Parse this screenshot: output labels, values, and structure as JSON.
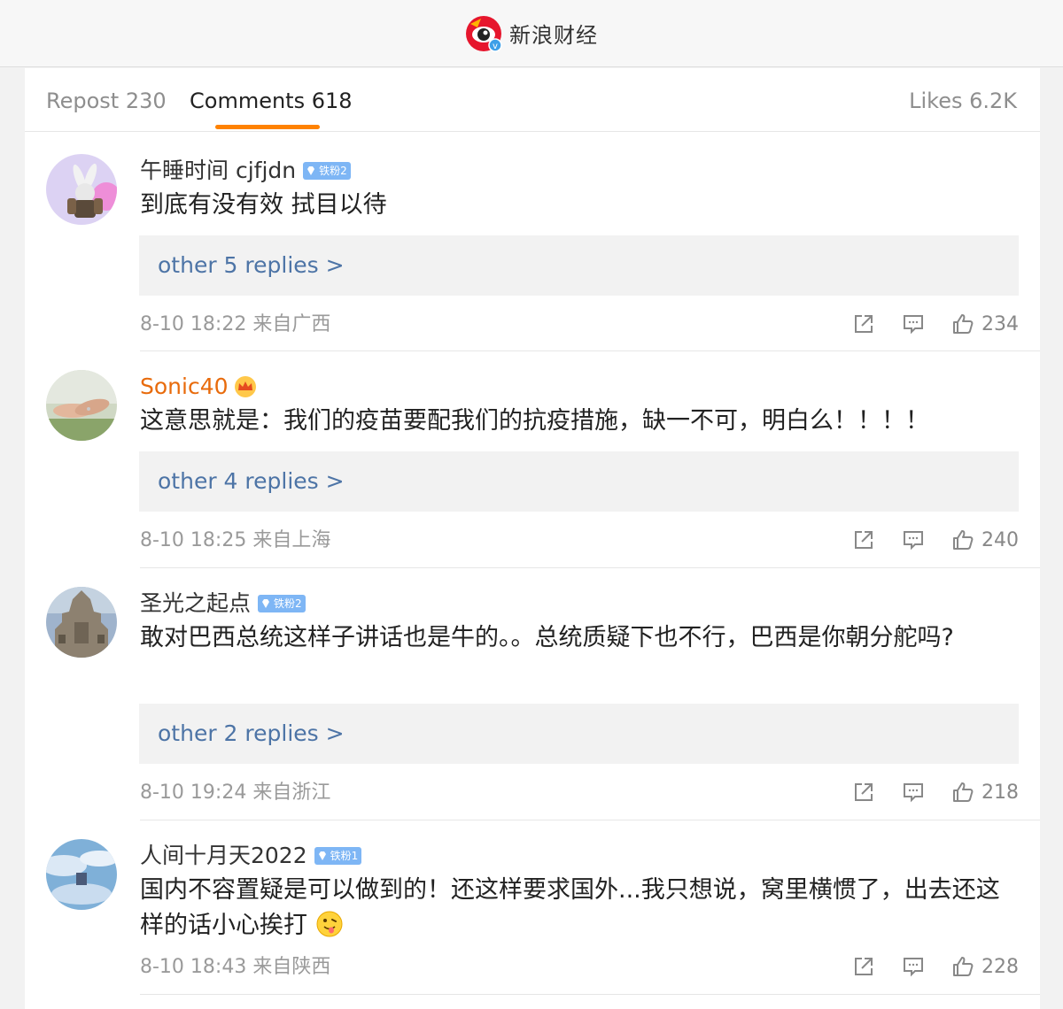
{
  "header": {
    "account_name": "新浪财经",
    "logo_icon": "sina-weibo-eye-logo"
  },
  "tabs": {
    "repost": "Repost 230",
    "comments": "Comments 618",
    "likes": "Likes 6.2K",
    "active_color": "#ff8200"
  },
  "comments": [
    {
      "username": "午睡时间 cjfjdn",
      "badge": "铁粉2",
      "text": "到底有没有效 拭目以待",
      "replies_label": "other 5 replies >",
      "meta": "8-10 18:22 来自广西",
      "likes": "234"
    },
    {
      "username": "Sonic40",
      "text": "这意思就是：我们的疫苗要配我们的抗疫措施，缺一不可，明白么！！！！",
      "replies_label": "other 4 replies >",
      "meta": "8-10 18:25 来自上海",
      "likes": "240"
    },
    {
      "username": "圣光之起点",
      "badge": "铁粉2",
      "text": "敢对巴西总统这样子讲话也是牛的。。总统质疑下也不行，巴西是你朝分舵吗?",
      "replies_label": "other 2 replies >",
      "meta": "8-10 19:24 来自浙江",
      "likes": "218"
    },
    {
      "username": "人间十月天2022",
      "badge": "铁粉1",
      "text": "国内不容置疑是可以做到的！还这样要求国外...我只想说，窝里横惯了，出去还这样的话小心挨打",
      "meta": "8-10 18:43 来自陕西",
      "likes": "228"
    }
  ],
  "colors": {
    "link": "#4d74a6",
    "vip_name": "#e86b0c",
    "badge": "#7eb6f5",
    "meta": "#9a9a9a"
  }
}
